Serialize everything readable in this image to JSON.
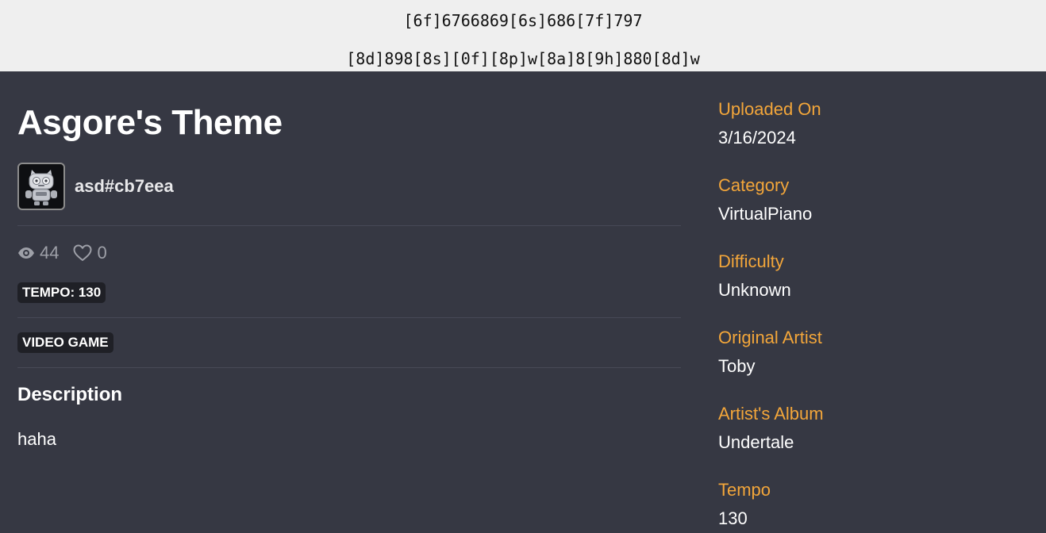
{
  "sheet_header": {
    "line1": "[6f]6766869[6s]686[7f]797",
    "line2": "[8d]898[8s][0f][8p]w[8a]8[9h]880[8d]w"
  },
  "song": {
    "title": "Asgore's Theme",
    "author": "asd#cb7eea",
    "views": "44",
    "likes": "0",
    "tempo_badge": "TEMPO: 130",
    "tag": "VIDEO GAME",
    "description_heading": "Description",
    "description": "haha"
  },
  "details": {
    "uploaded_label": "Uploaded On",
    "uploaded_value": "3/16/2024",
    "category_label": "Category",
    "category_value": "VirtualPiano",
    "difficulty_label": "Difficulty",
    "difficulty_value": "Unknown",
    "artist_label": "Original Artist",
    "artist_value": "Toby",
    "album_label": "Artist's Album",
    "album_value": "Undertale",
    "tempo_label": "Tempo",
    "tempo_value": "130"
  },
  "colors": {
    "background": "#363843",
    "accent": "#f3a63a",
    "header_background": "#efefef",
    "badge_background": "#1f2026"
  },
  "icons": {
    "views": "eye-icon",
    "likes": "heart-icon"
  }
}
